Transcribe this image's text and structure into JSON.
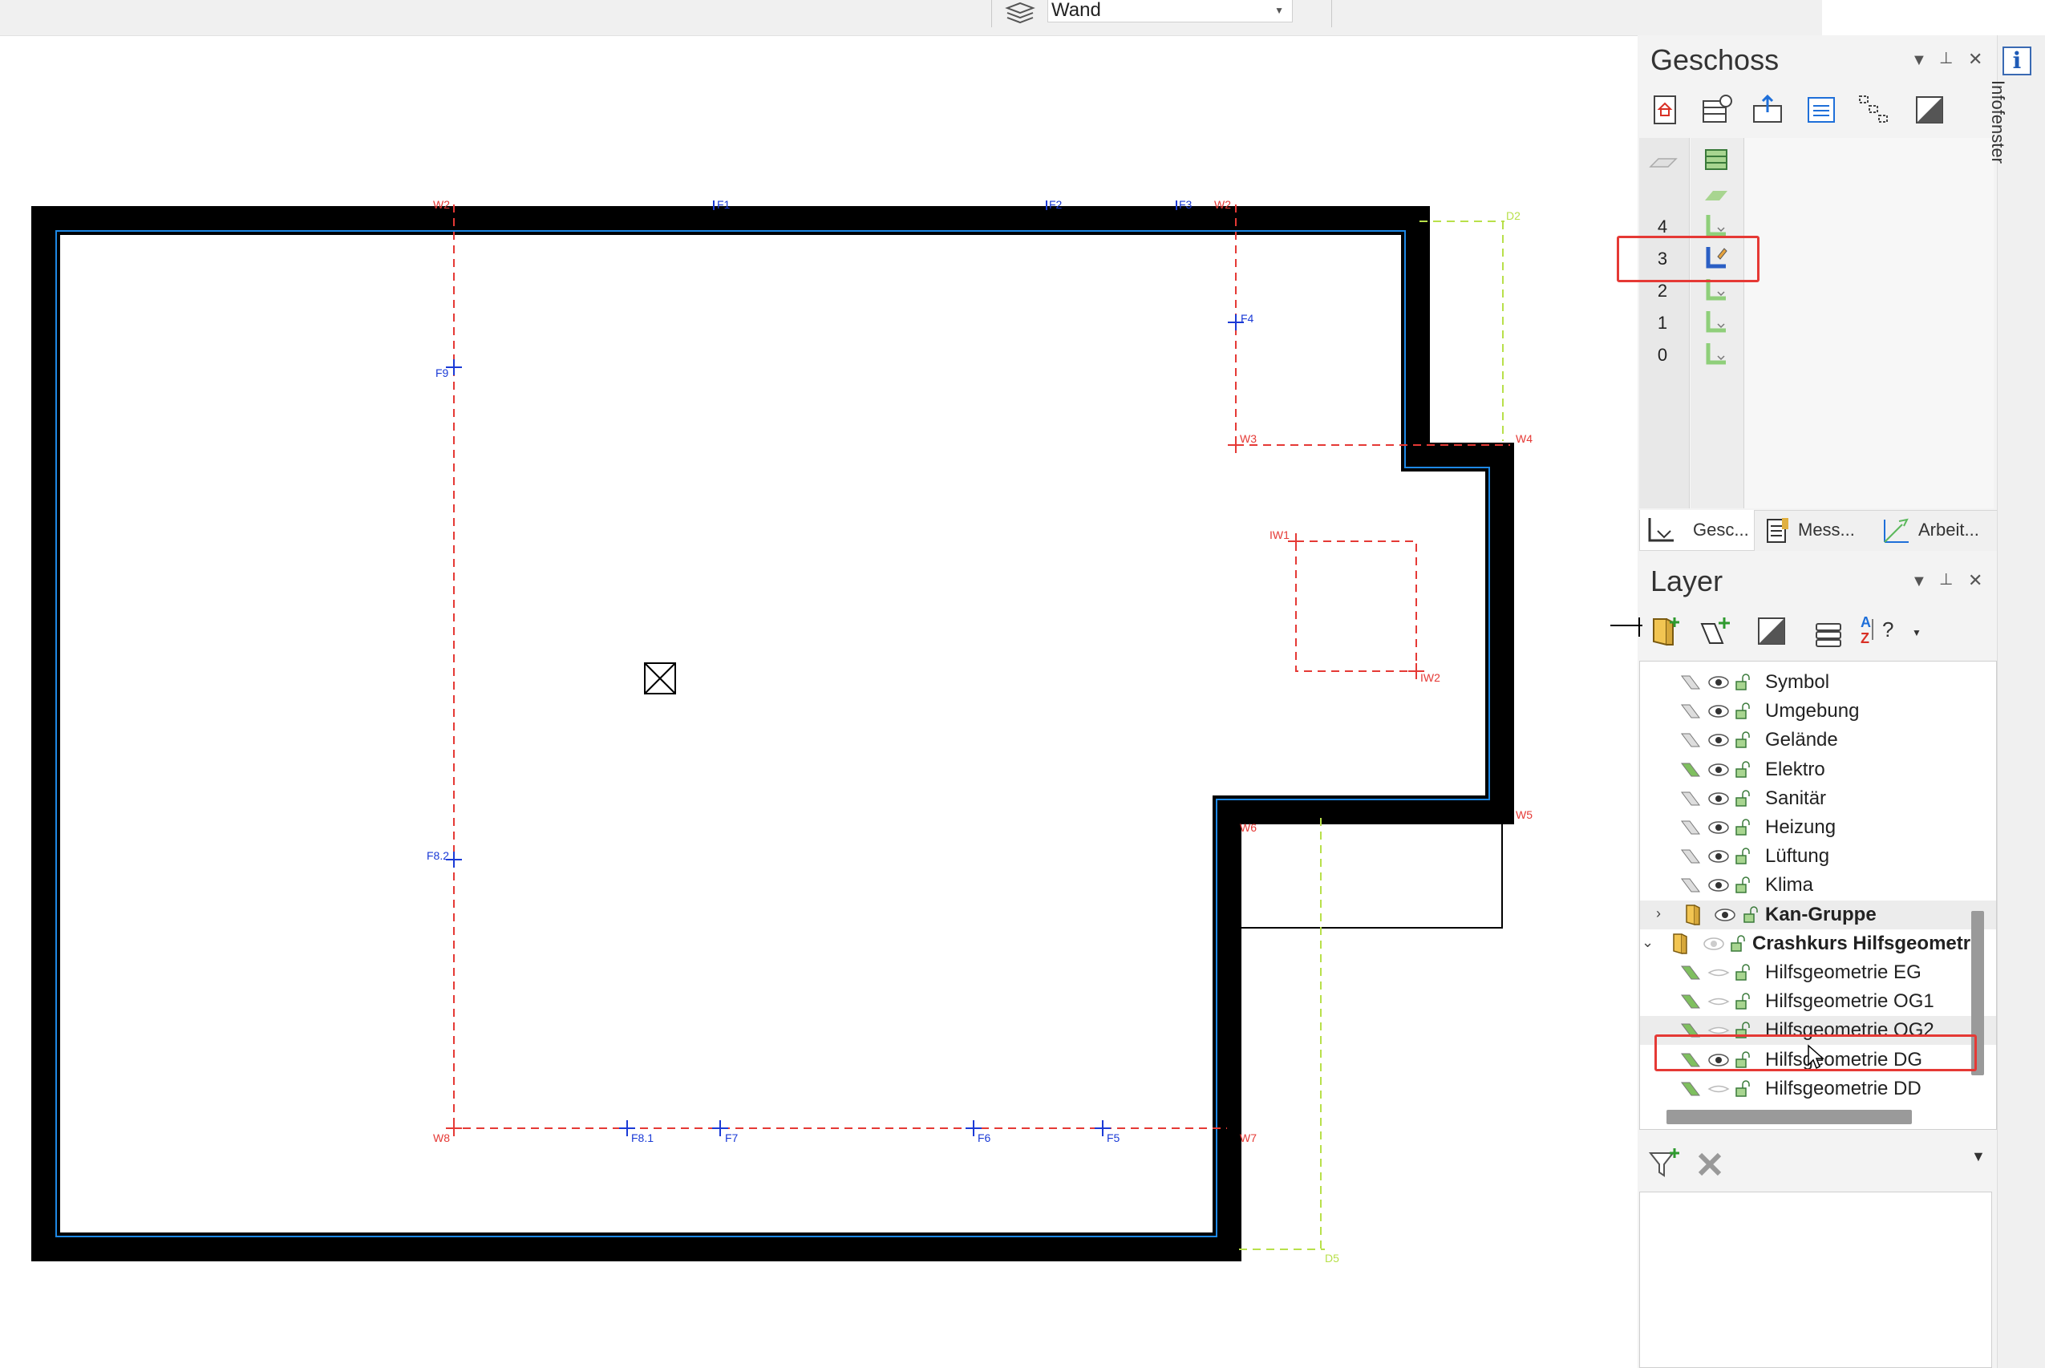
{
  "toolbar": {
    "layer_dropdown_value": "Wand"
  },
  "geschoss_panel": {
    "title": "Geschoss",
    "controls": {
      "menu": "▼",
      "pin": "⊥",
      "close": "✕"
    },
    "floors": [
      {
        "number": "4",
        "active": false
      },
      {
        "number": "3",
        "active": true
      },
      {
        "number": "2",
        "active": false
      },
      {
        "number": "1",
        "active": false
      },
      {
        "number": "0",
        "active": false
      }
    ],
    "tabs": [
      {
        "label": "Gesc...",
        "icon": "floor-icon"
      },
      {
        "label": "Mess...",
        "icon": "measure-icon"
      },
      {
        "label": "Arbeit...",
        "icon": "workplane-icon"
      }
    ]
  },
  "layer_panel": {
    "title": "Layer",
    "controls": {
      "menu": "▼",
      "pin": "⊥",
      "close": "✕"
    },
    "sort_label": "?",
    "items": [
      {
        "label": "Symbol",
        "type": "layer",
        "visible": true,
        "pen": "gray"
      },
      {
        "label": "Umgebung",
        "type": "layer",
        "visible": true,
        "pen": "gray"
      },
      {
        "label": "Gelände",
        "type": "layer",
        "visible": true,
        "pen": "gray"
      },
      {
        "label": "Elektro",
        "type": "layer",
        "visible": true,
        "pen": "green"
      },
      {
        "label": "Sanitär",
        "type": "layer",
        "visible": true,
        "pen": "gray"
      },
      {
        "label": "Heizung",
        "type": "layer",
        "visible": true,
        "pen": "gray"
      },
      {
        "label": "Lüftung",
        "type": "layer",
        "visible": true,
        "pen": "gray"
      },
      {
        "label": "Klima",
        "type": "layer",
        "visible": true,
        "pen": "gray"
      },
      {
        "label": "Kan-Gruppe",
        "type": "group",
        "expanded": false
      },
      {
        "label": "Crashkurs Hilfsgeometr",
        "type": "group",
        "expanded": true
      },
      {
        "label": "Hilfsgeometrie EG",
        "type": "layer",
        "visible": false,
        "pen": "green"
      },
      {
        "label": "Hilfsgeometrie OG1",
        "type": "layer",
        "visible": false,
        "pen": "green"
      },
      {
        "label": "Hilfsgeometrie OG2",
        "type": "layer",
        "visible": false,
        "pen": "green"
      },
      {
        "label": "Hilfsgeometrie DG",
        "type": "layer",
        "visible": true,
        "pen": "green"
      },
      {
        "label": "Hilfsgeometrie DD",
        "type": "layer",
        "visible": false,
        "pen": "green"
      }
    ]
  },
  "info_sidebar": {
    "label": "Infofenster",
    "icon_glyph": "i"
  },
  "drawing": {
    "labels": {
      "W2a": "W2",
      "F1": "F1",
      "F2": "F2",
      "F3": "F3",
      "W2b": "W2",
      "D2": "D2",
      "F4": "F4",
      "F9": "F9",
      "W3": "W3",
      "W4": "W4",
      "IW1": "IW1",
      "IW2": "IW2",
      "W5": "W5",
      "W6": "W6",
      "F8.2": "F8.2",
      "W8": "W8",
      "F8.1": "F8.1",
      "F7": "F7",
      "F6": "F6",
      "F5": "F5",
      "W7": "W7",
      "D5": "D5"
    },
    "colors": {
      "wall": "#000000",
      "inner_line": "#1e88e5",
      "help_red": "#e53935",
      "help_green": "#b8e04a",
      "marker_blue": "#1a3ad6"
    }
  }
}
